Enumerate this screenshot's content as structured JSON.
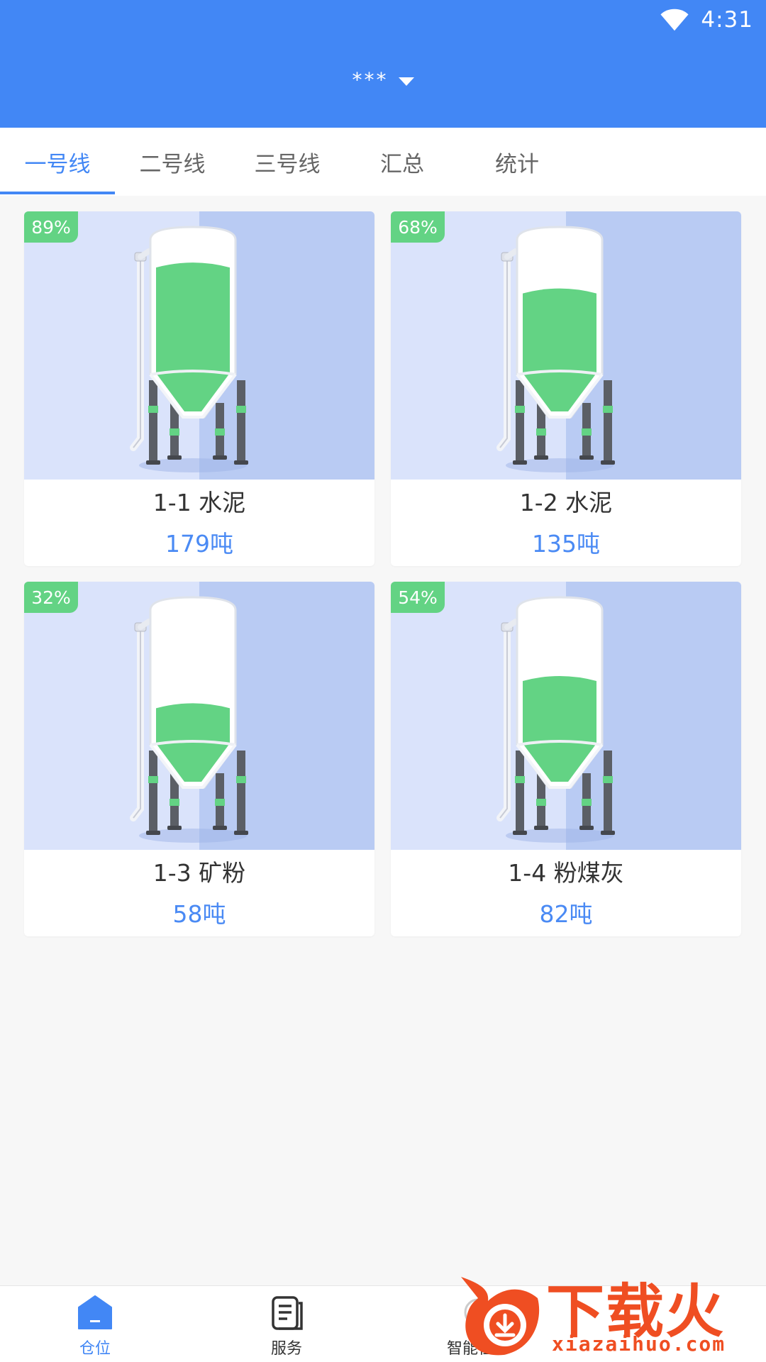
{
  "status_bar": {
    "time": "4:31"
  },
  "header": {
    "title": "***"
  },
  "tabs": [
    {
      "label": "一号线",
      "active": true
    },
    {
      "label": "二号线",
      "active": false
    },
    {
      "label": "三号线",
      "active": false
    },
    {
      "label": "汇总",
      "active": false
    },
    {
      "label": "统计",
      "active": false
    }
  ],
  "silos": [
    {
      "name": "1-1 水泥",
      "quantity": "179吨",
      "percent_label": "89%",
      "fill_level": 0.89
    },
    {
      "name": "1-2 水泥",
      "quantity": "135吨",
      "percent_label": "68%",
      "fill_level": 0.68
    },
    {
      "name": "1-3 矿粉",
      "quantity": "58吨",
      "percent_label": "32%",
      "fill_level": 0.32
    },
    {
      "name": "1-4 粉煤灰",
      "quantity": "82吨",
      "percent_label": "54%",
      "fill_level": 0.54
    }
  ],
  "bottom_nav": [
    {
      "label": "仓位",
      "icon": "home-icon",
      "active": true
    },
    {
      "label": "服务",
      "icon": "document-icon",
      "active": false
    },
    {
      "label": "智能任务",
      "icon": "task-icon",
      "active": false
    }
  ],
  "watermark": {
    "text": "下载火",
    "subtext": "xiazaihuo.com"
  },
  "colors": {
    "primary": "#4287f5",
    "fill_green": "#63d384",
    "quantity_blue": "#4a8af4",
    "watermark_orange": "#ef4e22"
  }
}
